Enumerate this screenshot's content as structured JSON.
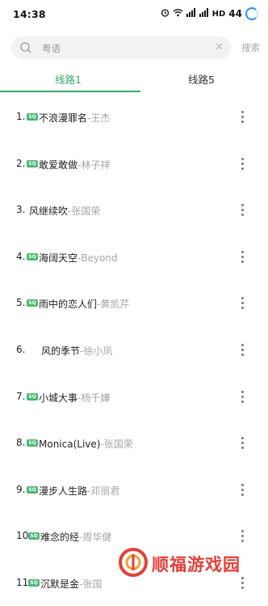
{
  "status_bar": {
    "time": "14:38",
    "network": "HD",
    "battery": "44"
  },
  "search": {
    "query": "粤语",
    "button_label": "搜索"
  },
  "tabs": [
    {
      "label": "线路1",
      "active": true
    },
    {
      "label": "线路5",
      "active": false
    }
  ],
  "quality_badge": "SQ",
  "songs": [
    {
      "index": "1.",
      "sq": true,
      "title": "不浪漫罪名",
      "artist": "-王杰"
    },
    {
      "index": "2.",
      "sq": true,
      "title": "敢爱敢做",
      "artist": "-林子祥"
    },
    {
      "index": "3.",
      "sq": false,
      "title": "风继续吹",
      "artist": "-张国荣"
    },
    {
      "index": "4.",
      "sq": true,
      "title": "海阔天空",
      "artist": "-Beyond"
    },
    {
      "index": "5.",
      "sq": true,
      "title": "雨中的恋人们",
      "artist": "-黄凯芹"
    },
    {
      "index": "6.",
      "sq": false,
      "title": "风的季节",
      "artist": "-徐小凤"
    },
    {
      "index": "7.",
      "sq": true,
      "title": "小城大事",
      "artist": "-杨千嬅"
    },
    {
      "index": "8.",
      "sq": true,
      "title": "Monica(Live)",
      "artist": "-张国荣"
    },
    {
      "index": "9.",
      "sq": true,
      "title": "漫步人生路",
      "artist": "-邓丽君"
    },
    {
      "index": "10.",
      "sq": true,
      "title": "难念的经",
      "artist": "-周华健"
    },
    {
      "index": "11.",
      "sq": true,
      "title": "沉默是金",
      "artist": "-张国"
    }
  ],
  "watermark": {
    "text": "顺福游戏园"
  },
  "colors": {
    "accent": "#39a86b",
    "badge": "#4cb776",
    "artist": "#a5a5a5",
    "watermark": "#e2403a"
  }
}
